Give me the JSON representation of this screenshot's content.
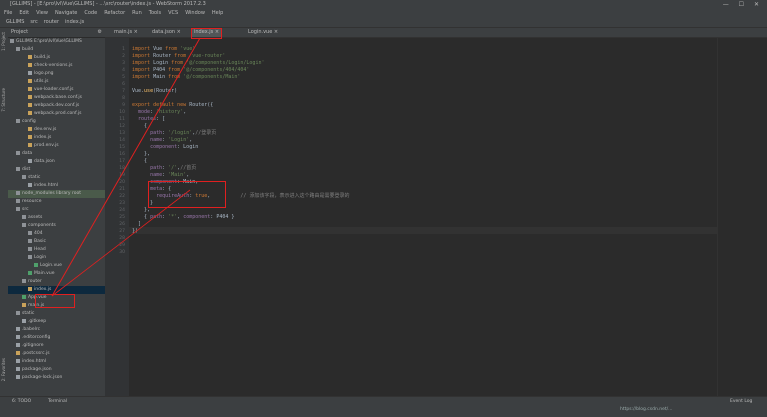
{
  "window": {
    "title": "[GLLIMS] - [E:\\pro\\lvl\\Vue\\GLLIMS] - ...\\src\\router\\index.js - WebStorm 2017.2.3"
  },
  "menu": [
    "File",
    "Edit",
    "View",
    "Navigate",
    "Code",
    "Refactor",
    "Run",
    "Tools",
    "VCS",
    "Window",
    "Help"
  ],
  "breadcrumb": [
    "GLLIMS",
    "src",
    "router",
    "index.js"
  ],
  "project_panel_title": "Project",
  "tabs": [
    {
      "label": "main.js",
      "active": false
    },
    {
      "label": "data.json",
      "active": false
    },
    {
      "label": "index.js",
      "active": true
    },
    {
      "label": "Login.vue",
      "active": false
    }
  ],
  "tree": [
    {
      "label": "GLLIMS  E:\\pro\\lvl\\Vue\\GLLIMS",
      "icon": "fold",
      "indent": 0
    },
    {
      "label": "build",
      "icon": "fold",
      "indent": 1
    },
    {
      "label": "build.js",
      "icon": "js",
      "indent": 3
    },
    {
      "label": "check-versions.js",
      "icon": "js",
      "indent": 3
    },
    {
      "label": "logo.png",
      "icon": "file",
      "indent": 3
    },
    {
      "label": "utils.js",
      "icon": "js",
      "indent": 3
    },
    {
      "label": "vue-loader.conf.js",
      "icon": "js",
      "indent": 3
    },
    {
      "label": "webpack.base.conf.js",
      "icon": "js",
      "indent": 3
    },
    {
      "label": "webpack.dev.conf.js",
      "icon": "js",
      "indent": 3
    },
    {
      "label": "webpack.prod.conf.js",
      "icon": "js",
      "indent": 3
    },
    {
      "label": "config",
      "icon": "fold",
      "indent": 1
    },
    {
      "label": "dev.env.js",
      "icon": "js",
      "indent": 3
    },
    {
      "label": "index.js",
      "icon": "js",
      "indent": 3
    },
    {
      "label": "prod.env.js",
      "icon": "js",
      "indent": 3
    },
    {
      "label": "data",
      "icon": "fold",
      "indent": 1
    },
    {
      "label": "data.json",
      "icon": "file",
      "indent": 3
    },
    {
      "label": "dist",
      "icon": "fold",
      "indent": 1
    },
    {
      "label": "static",
      "icon": "fold",
      "indent": 2
    },
    {
      "label": "index.html",
      "icon": "file",
      "indent": 3
    },
    {
      "label": "node_modules  library root",
      "icon": "fold",
      "indent": 1,
      "highlight": true
    },
    {
      "label": "resource",
      "icon": "fold",
      "indent": 1
    },
    {
      "label": "src",
      "icon": "fold",
      "indent": 1
    },
    {
      "label": "assets",
      "icon": "fold",
      "indent": 2
    },
    {
      "label": "components",
      "icon": "fold",
      "indent": 2
    },
    {
      "label": "404",
      "icon": "fold",
      "indent": 3
    },
    {
      "label": "Basic",
      "icon": "fold",
      "indent": 3
    },
    {
      "label": "Head",
      "icon": "fold",
      "indent": 3
    },
    {
      "label": "Login",
      "icon": "fold",
      "indent": 3
    },
    {
      "label": "Login.vue",
      "icon": "vue",
      "indent": 4
    },
    {
      "label": "Main.vue",
      "icon": "vue",
      "indent": 3
    },
    {
      "label": "router",
      "icon": "fold",
      "indent": 2
    },
    {
      "label": "index.js",
      "icon": "js",
      "indent": 3,
      "selected": true
    },
    {
      "label": "App.vue",
      "icon": "vue",
      "indent": 2
    },
    {
      "label": "main.js",
      "icon": "js",
      "indent": 2
    },
    {
      "label": "static",
      "icon": "fold",
      "indent": 1
    },
    {
      "label": ".gitkeep",
      "icon": "file",
      "indent": 2
    },
    {
      "label": ".babelrc",
      "icon": "file",
      "indent": 1
    },
    {
      "label": ".editorconfig",
      "icon": "file",
      "indent": 1
    },
    {
      "label": ".gitignore",
      "icon": "file",
      "indent": 1
    },
    {
      "label": ".postcssrc.js",
      "icon": "js",
      "indent": 1
    },
    {
      "label": "index.html",
      "icon": "file",
      "indent": 1
    },
    {
      "label": "package.json",
      "icon": "file",
      "indent": 1
    },
    {
      "label": "package-lock.json",
      "icon": "file",
      "indent": 1
    }
  ],
  "code_lines": [
    [
      [
        "kw",
        "import "
      ],
      [
        "",
        "Vue "
      ],
      [
        "kw",
        "from "
      ],
      [
        "str",
        "'vue'"
      ]
    ],
    [
      [
        "kw",
        "import "
      ],
      [
        "",
        "Router "
      ],
      [
        "kw",
        "from "
      ],
      [
        "str",
        "'vue-router'"
      ]
    ],
    [
      [
        "kw",
        "import "
      ],
      [
        "",
        "Login "
      ],
      [
        "kw",
        "from "
      ],
      [
        "str",
        "'@/components/Login/Login'"
      ]
    ],
    [
      [
        "kw",
        "import "
      ],
      [
        "",
        "P404 "
      ],
      [
        "kw",
        "from "
      ],
      [
        "str",
        "'@/components/404/404'"
      ]
    ],
    [
      [
        "kw",
        "import "
      ],
      [
        "",
        "Main "
      ],
      [
        "kw",
        "from "
      ],
      [
        "str",
        "'@/components/Main'"
      ]
    ],
    [
      [
        "",
        ""
      ]
    ],
    [
      [
        "",
        "Vue."
      ],
      [
        "fn",
        "use"
      ],
      [
        "",
        "(Router)"
      ]
    ],
    [
      [
        "",
        ""
      ]
    ],
    [
      [
        "kw",
        "export default new "
      ],
      [
        "",
        "Router({"
      ]
    ],
    [
      [
        "",
        "  "
      ],
      [
        "prop",
        "mode"
      ],
      [
        "",
        ": "
      ],
      [
        "str",
        "'history'"
      ],
      [
        "",
        ","
      ]
    ],
    [
      [
        "",
        "  "
      ],
      [
        "prop",
        "routes"
      ],
      [
        "",
        ": ["
      ]
    ],
    [
      [
        "",
        "    {"
      ]
    ],
    [
      [
        "",
        "      "
      ],
      [
        "prop",
        "path"
      ],
      [
        "",
        ": "
      ],
      [
        "str",
        "'/login'"
      ],
      [
        "",
        ","
      ],
      [
        "cm",
        "//登录页"
      ]
    ],
    [
      [
        "",
        "      "
      ],
      [
        "prop",
        "name"
      ],
      [
        "",
        ": "
      ],
      [
        "str",
        "'Login'"
      ],
      [
        "",
        ","
      ]
    ],
    [
      [
        "",
        "      "
      ],
      [
        "prop",
        "component"
      ],
      [
        "",
        ": Login"
      ]
    ],
    [
      [
        "",
        "    },"
      ]
    ],
    [
      [
        "",
        "    {"
      ]
    ],
    [
      [
        "",
        "      "
      ],
      [
        "prop",
        "path"
      ],
      [
        "",
        ": "
      ],
      [
        "str",
        "'/'"
      ],
      [
        "",
        ","
      ],
      [
        "cm",
        "//首页"
      ]
    ],
    [
      [
        "",
        "      "
      ],
      [
        "prop",
        "name"
      ],
      [
        "",
        ": "
      ],
      [
        "str",
        "'Main'"
      ],
      [
        "",
        ","
      ]
    ],
    [
      [
        "",
        "      "
      ],
      [
        "prop",
        "component"
      ],
      [
        "",
        ": Main,"
      ]
    ],
    [
      [
        "",
        "      "
      ],
      [
        "prop",
        "meta"
      ],
      [
        "",
        ": {"
      ]
    ],
    [
      [
        "",
        "        "
      ],
      [
        "prop",
        "requireAuth"
      ],
      [
        "",
        ": "
      ],
      [
        "kw",
        "true"
      ],
      [
        "",
        ","
      ],
      [
        "cm",
        "          // 添加该字段，表示进入这个路由是需要登录的"
      ]
    ],
    [
      [
        "",
        "      }"
      ]
    ],
    [
      [
        "",
        "    },"
      ]
    ],
    [
      [
        "",
        "    { "
      ],
      [
        "prop",
        "path"
      ],
      [
        "",
        ": "
      ],
      [
        "str",
        "'*'"
      ],
      [
        "",
        ", "
      ],
      [
        "prop",
        "component"
      ],
      [
        "",
        ": P404 }"
      ]
    ],
    [
      [
        "",
        "  ]"
      ]
    ],
    [
      [
        "",
        "})"
      ]
    ],
    [
      [
        "",
        ""
      ]
    ],
    [
      [
        "",
        ""
      ]
    ],
    [
      [
        "",
        ""
      ]
    ]
  ],
  "status": {
    "todo": "6: TODO",
    "terminal": "Terminal",
    "event_log": "Event Log",
    "watermark": "https://blog.csdn.net/..."
  },
  "side_tabs": [
    "1: Project",
    "7: Structure",
    "2: Favorites"
  ]
}
